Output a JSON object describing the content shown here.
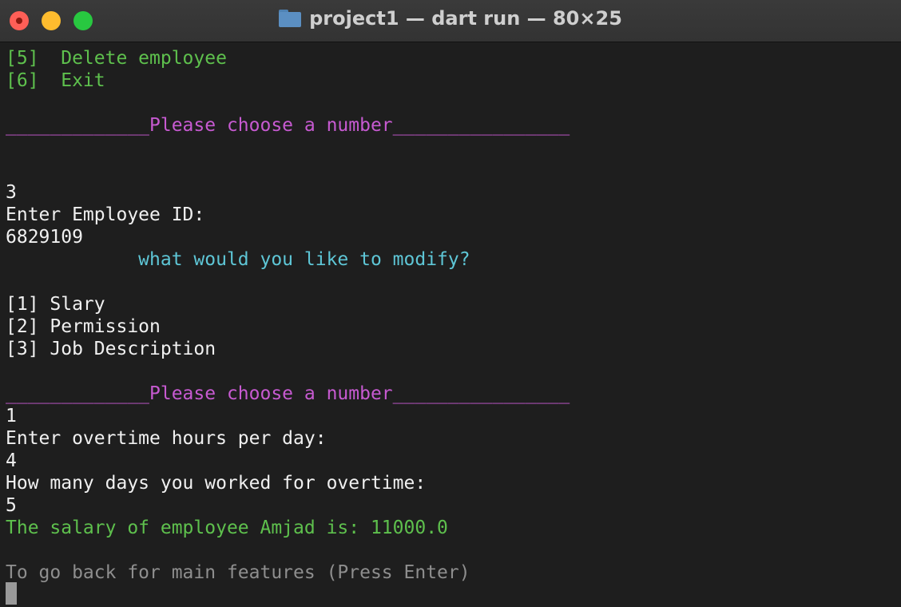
{
  "window": {
    "title": "project1 — dart run — 80×25",
    "folder_icon": "folder-icon"
  },
  "terminal": {
    "lines": [
      "[5]  Delete employee",
      "[6]  Exit",
      "_____________Please choose a number________________",
      "3",
      "Enter Employee ID:",
      "6829109",
      "            what would you like to modify?",
      "[1] Slary",
      "[2] Permission",
      "[3] Job Description",
      "_____________Please choose a number________________",
      "1",
      "Enter overtime hours per day:",
      "4",
      "How many days you worked for overtime:",
      "5",
      "The salary of employee Amjad is: 11000.0",
      "To go back for main features (Press Enter)"
    ]
  },
  "colors": {
    "green": "#5ec04d",
    "magenta": "#c75ad1",
    "cyan": "#5ec6d6",
    "white": "#f0f0f0",
    "gray": "#8e8e8e",
    "background": "#1e1e1e"
  }
}
